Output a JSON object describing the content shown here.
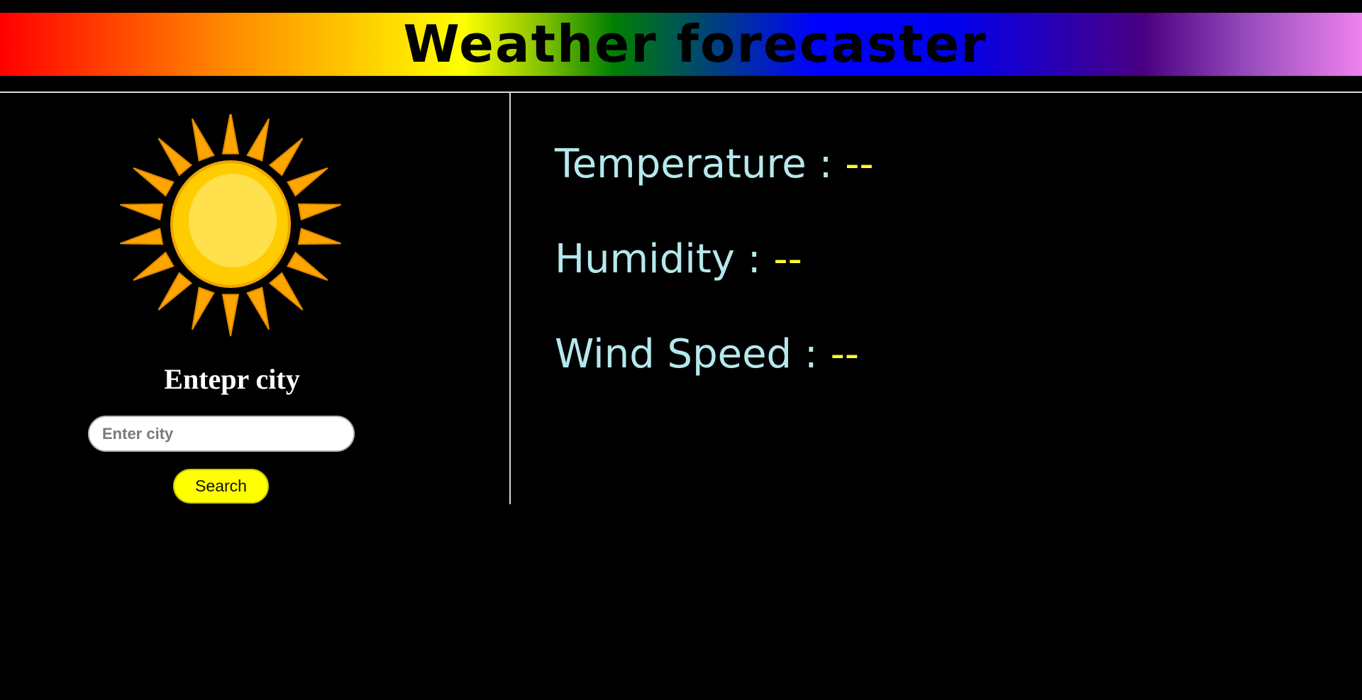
{
  "header": {
    "title": "Weather forecaster"
  },
  "sidebar": {
    "icon": "sun-icon",
    "heading": "Entepr city",
    "input": {
      "placeholder": "Enter city",
      "value": ""
    },
    "search_label": "Search"
  },
  "metrics": [
    {
      "label": "Temperature :",
      "value": "--"
    },
    {
      "label": "Humidity :",
      "value": "--"
    },
    {
      "label": "Wind Speed :",
      "value": "--"
    }
  ],
  "colors": {
    "background": "#000000",
    "metric_label": "#b5e8ec",
    "metric_value": "#ffff33",
    "button": "#ffff00",
    "sun_core": "#ffcc00",
    "sun_rays": "#ffa500"
  }
}
